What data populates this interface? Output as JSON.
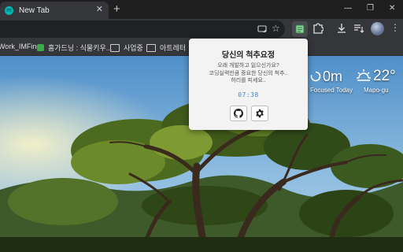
{
  "browser": {
    "tab": {
      "title": "New Tab",
      "favicon": "momentum-favicon",
      "favicon_letter": "m",
      "close_icon": "close-icon"
    },
    "new_tab_icon": "plus-icon",
    "window_controls": [
      "minimize-icon",
      "restore-icon",
      "close-icon"
    ],
    "toolbar_icons": [
      "cast-icon",
      "star-icon",
      "extension-active-icon",
      "puzzle-icon",
      "download-icon",
      "reading-list-icon",
      "profile-avatar"
    ]
  },
  "bookmarks": [
    {
      "label": "Work_IMFine",
      "icon": "none"
    },
    {
      "label": "홈가드닝 : 식물키우...",
      "icon": "green-favicon"
    },
    {
      "label": "사업중",
      "icon": "folder-icon"
    },
    {
      "label": "아트레터",
      "icon": "folder-icon"
    }
  ],
  "widgets": {
    "focus": {
      "value": "0m",
      "label": "Focused Today"
    },
    "weather": {
      "temperature": "22°",
      "location": "Mapo-gu",
      "icon": "sunrise-icon"
    }
  },
  "popup": {
    "title": "당신의 척추요정",
    "message_lines": [
      "오래 개발하고 잃으신가요?",
      "코딩실력만큼 중요한 당신의 척추..",
      "허리를 피세요.."
    ],
    "timer": "07:38",
    "buttons": [
      {
        "name": "github-button",
        "icon": "github-icon"
      },
      {
        "name": "settings-button",
        "icon": "gear-icon"
      }
    ]
  },
  "colors": {
    "tab_bg": "#35363a",
    "titlebar_bg": "#1f1f1f",
    "popup_bg": "#f3f3f3",
    "timer_color": "#3a8ed8",
    "favicon_color": "#00b6b3"
  }
}
